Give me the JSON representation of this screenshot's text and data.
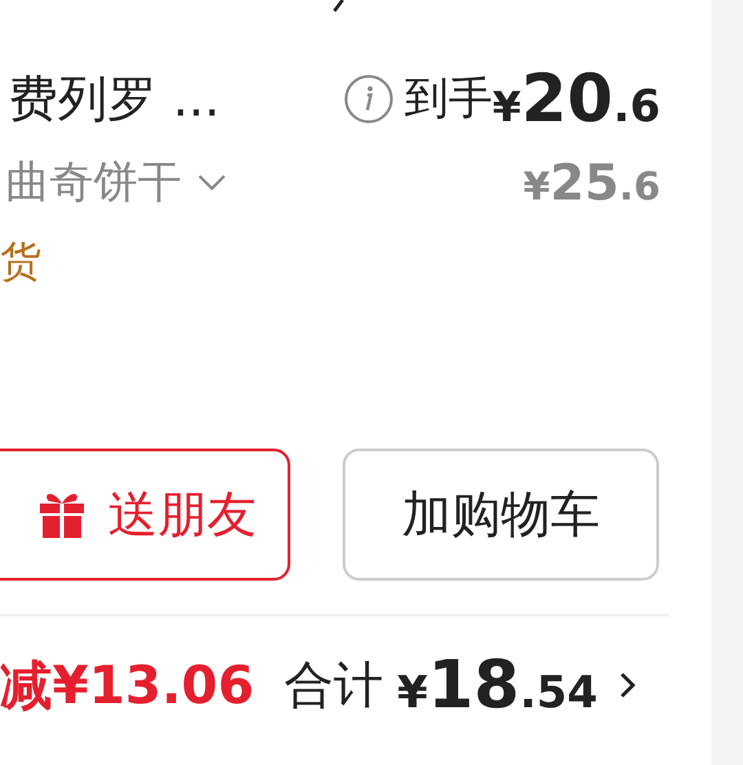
{
  "product": {
    "title": "费列罗 ...",
    "variant": "曲奇饼干",
    "price_label": "到手",
    "final_price": {
      "symbol": "¥",
      "whole": "20",
      "fraction": ".6"
    },
    "original_price": {
      "symbol": "¥",
      "whole": "25",
      "fraction": ".6"
    },
    "tag": "货"
  },
  "buttons": [
    {
      "kind": "gift",
      "label": "送朋友"
    },
    {
      "kind": "cart",
      "label": "加购物车"
    }
  ],
  "footer": {
    "discount": "减¥13.06",
    "total_label": "合计",
    "total": {
      "symbol": "¥",
      "whole": "18",
      "fraction": ".54"
    }
  }
}
